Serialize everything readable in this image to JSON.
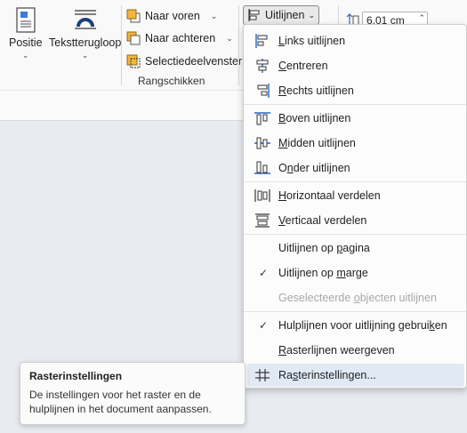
{
  "ribbon": {
    "position_btn": {
      "label": "Positie",
      "icon": "position-icon"
    },
    "wrap_btn": {
      "label": "Tekstterugloop",
      "icon": "text-wrap-icon"
    },
    "bring_forward": {
      "label": "Naar voren",
      "icon": "bring-forward-icon"
    },
    "send_backward": {
      "label": "Naar achteren",
      "icon": "send-backward-icon"
    },
    "selection_pane": {
      "label": "Selectiedeelvenster",
      "icon": "selection-pane-icon"
    },
    "group_label": "Rangschikken",
    "align_btn": {
      "label": "Uitlijnen",
      "icon": "align-icon"
    },
    "height_value": "6.01 cm"
  },
  "menu": {
    "items": [
      {
        "label": "Links uitlijnen",
        "accel": "L",
        "icon": "align-left-icon"
      },
      {
        "label": "Centreren",
        "accel": "C",
        "icon": "align-center-icon"
      },
      {
        "label": "Rechts uitlijnen",
        "accel": "R",
        "icon": "align-right-icon"
      },
      {
        "label": "Boven uitlijnen",
        "accel": "B",
        "icon": "align-top-icon"
      },
      {
        "label": "Midden uitlijnen",
        "accel": "M",
        "icon": "align-middle-icon"
      },
      {
        "label": "Onder uitlijnen",
        "accel": "n",
        "icon": "align-bottom-icon"
      },
      {
        "label": "Horizontaal verdelen",
        "accel": "H",
        "icon": "distribute-horizontal-icon"
      },
      {
        "label": "Verticaal verdelen",
        "accel": "V",
        "icon": "distribute-vertical-icon"
      },
      {
        "label": "Uitlijnen op pagina",
        "accel": "p"
      },
      {
        "label": "Uitlijnen op marge",
        "accel": "m",
        "checked": true
      },
      {
        "label": "Geselecteerde objecten uitlijnen",
        "accel": "o",
        "disabled": true
      },
      {
        "label": "Hulplijnen voor uitlijning gebruiken",
        "accel": "k",
        "checked": true
      },
      {
        "label": "Rasterlijnen weergeven",
        "accel": "R"
      },
      {
        "label": "Rasterinstellingen...",
        "accel": "s",
        "icon": "grid-icon",
        "highlighted": true
      }
    ]
  },
  "tooltip": {
    "title": "Rasterinstellingen",
    "body": "De instellingen voor het raster en de hulplijnen in het document aanpassen."
  },
  "colors": {
    "accent": "#2b64c6",
    "highlight": "#e1e9f5",
    "icon_fill": "#f4b63a"
  }
}
